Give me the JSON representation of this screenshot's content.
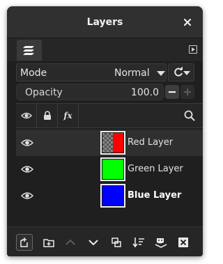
{
  "window": {
    "title": "Layers"
  },
  "tabs": [
    {
      "icon": "layers-stack-icon",
      "active": true
    }
  ],
  "mode": {
    "label": "Mode",
    "value": "Normal"
  },
  "opacity": {
    "label": "Opacity",
    "value": "100.0"
  },
  "header": {
    "fx_label": "fx"
  },
  "layers": [
    {
      "name": "Red Layer",
      "visible": true,
      "thumb_colors": [
        "checker",
        "#ff0000"
      ],
      "selected": true,
      "bold": false
    },
    {
      "name": "Green Layer",
      "visible": true,
      "thumb_colors": [
        "#00ff00"
      ],
      "selected": false,
      "bold": false
    },
    {
      "name": "Blue Layer",
      "visible": true,
      "thumb_colors": [
        "#0000ff"
      ],
      "selected": false,
      "bold": true
    }
  ],
  "bottom_buttons": [
    "new-layer-icon",
    "new-layer-group-icon",
    "raise-layer-icon",
    "lower-layer-icon",
    "duplicate-layer-icon",
    "merge-down-icon",
    "layer-mask-icon",
    "delete-layer-icon"
  ],
  "colors": {
    "background": "#1f1f1f",
    "titlebar": "#303030",
    "selected_row": "#2f2f2f",
    "text": "#e4e4e4"
  }
}
